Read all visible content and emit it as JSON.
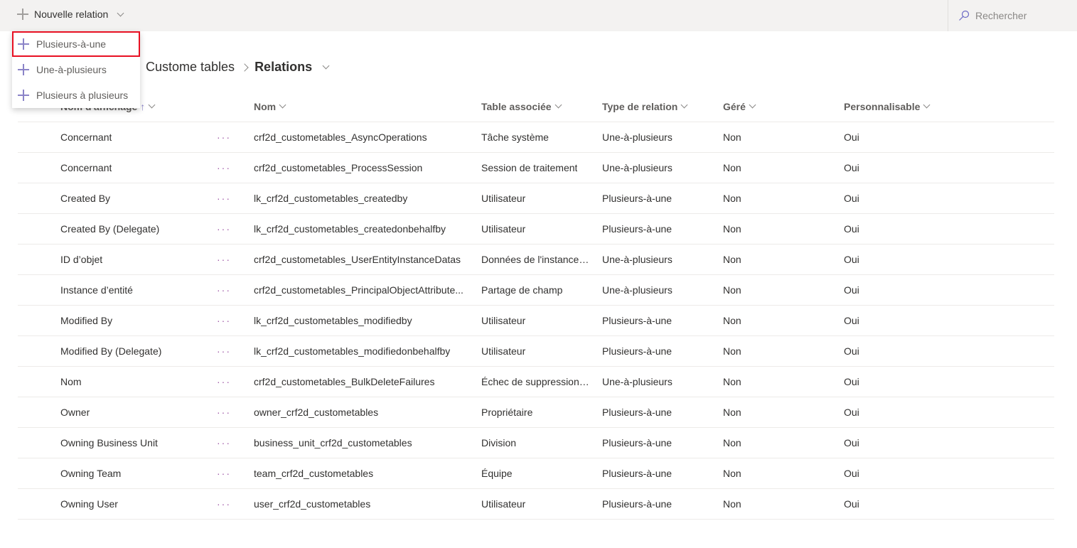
{
  "toolbar": {
    "new_relation": "Nouvelle relation",
    "search_placeholder": "Rechercher"
  },
  "menu": {
    "items": [
      {
        "label": "Plusieurs-à-une",
        "highlighted": true
      },
      {
        "label": "Une-à-plusieurs"
      },
      {
        "label": "Plusieurs à plusieurs"
      }
    ]
  },
  "breadcrumb": {
    "parent": "Custome tables",
    "current": "Relations"
  },
  "table": {
    "headers": [
      "Nom d'affichage",
      "Nom",
      "Table associée",
      "Type de relation",
      "Géré",
      "Personnalisable"
    ],
    "sort_indicator": "↑",
    "more": "···",
    "rows": [
      [
        "Concernant",
        "crf2d_custometables_AsyncOperations",
        "Tâche système",
        "Une-à-plusieurs",
        "Non",
        "Oui"
      ],
      [
        "Concernant",
        "crf2d_custometables_ProcessSession",
        "Session de traitement",
        "Une-à-plusieurs",
        "Non",
        "Oui"
      ],
      [
        "Created By",
        "lk_crf2d_custometables_createdby",
        "Utilisateur",
        "Plusieurs-à-une",
        "Non",
        "Oui"
      ],
      [
        "Created By (Delegate)",
        "lk_crf2d_custometables_createdonbehalfby",
        "Utilisateur",
        "Plusieurs-à-une",
        "Non",
        "Oui"
      ],
      [
        "ID d’objet",
        "crf2d_custometables_UserEntityInstanceDatas",
        "Données de l'instance ...",
        "Une-à-plusieurs",
        "Non",
        "Oui"
      ],
      [
        "Instance d’entité",
        "crf2d_custometables_PrincipalObjectAttribute...",
        "Partage de champ",
        "Une-à-plusieurs",
        "Non",
        "Oui"
      ],
      [
        "Modified By",
        "lk_crf2d_custometables_modifiedby",
        "Utilisateur",
        "Plusieurs-à-une",
        "Non",
        "Oui"
      ],
      [
        "Modified By (Delegate)",
        "lk_crf2d_custometables_modifiedonbehalfby",
        "Utilisateur",
        "Plusieurs-à-une",
        "Non",
        "Oui"
      ],
      [
        "Nom",
        "crf2d_custometables_BulkDeleteFailures",
        "Échec de suppression ...",
        "Une-à-plusieurs",
        "Non",
        "Oui"
      ],
      [
        "Owner",
        "owner_crf2d_custometables",
        "Propriétaire",
        "Plusieurs-à-une",
        "Non",
        "Oui"
      ],
      [
        "Owning Business Unit",
        "business_unit_crf2d_custometables",
        "Division",
        "Plusieurs-à-une",
        "Non",
        "Oui"
      ],
      [
        "Owning Team",
        "team_crf2d_custometables",
        "Équipe",
        "Plusieurs-à-une",
        "Non",
        "Oui"
      ],
      [
        "Owning User",
        "user_crf2d_custometables",
        "Utilisateur",
        "Plusieurs-à-une",
        "Non",
        "Oui"
      ]
    ]
  }
}
